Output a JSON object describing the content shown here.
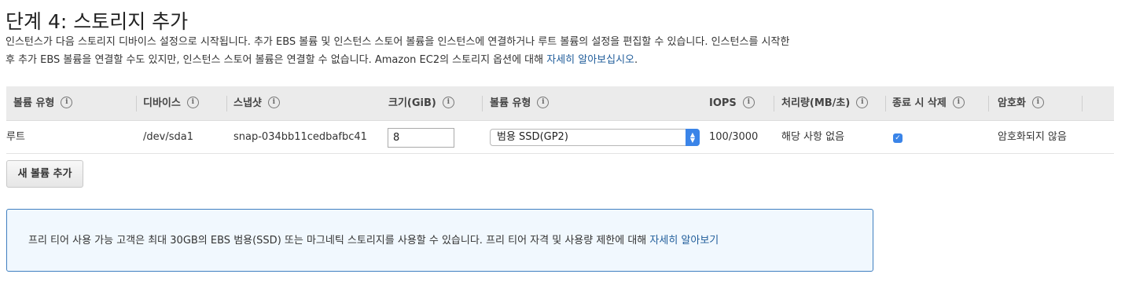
{
  "page": {
    "title": "단계 4: 스토리지 추가",
    "description_line1": "인스턴스가 다음 스토리지 디바이스 설정으로 시작됩니다. 추가 EBS 볼륨 및 인스턴스 스토어 볼륨을 인스턴스에 연결하거나 루트 볼륨의 설정을 편집할 수 있습니다. 인스턴스를 시작한",
    "description_line2": "후 추가 EBS 볼륨을 연결할 수도 있지만, 인스턴스 스토어 볼륨은 연결할 수 없습니다. Amazon EC2의 스토리지 옵션에 대해 ",
    "description_link": "자세히 알아보십시오",
    "description_end": "."
  },
  "table": {
    "info_glyph": "i",
    "headers": {
      "volume_type": "볼륨 유형",
      "device": "디바이스",
      "snapshot": "스냅샷",
      "size": "크기(GiB)",
      "volume_kind": "볼륨 유형",
      "iops": "IOPS",
      "throughput": "처리량(MB/초)",
      "delete_on_termination": "종료 시 삭제",
      "encryption": "암호화"
    },
    "row": {
      "volume_type": "루트",
      "device": "/dev/sda1",
      "snapshot": "snap-034bb11cedbafbc41",
      "size": "8",
      "volume_kind": "범용 SSD(GP2)",
      "iops": "100/3000",
      "throughput": "해당 사항 없음",
      "delete_on_termination": true,
      "encryption": "암호화되지 않음"
    }
  },
  "add_volume_button": "새 볼륨 추가",
  "notice": {
    "text": "프리 티어 사용 가능 고객은 최대 30GB의 EBS 범용(SSD) 또는 마그네틱 스토리지를 사용할 수 있습니다. 프리 티어 자격 및 사용량 제한에 대해 ",
    "link": "자세히 알아보기"
  },
  "colors": {
    "link": "#1f5c9a",
    "accent": "#3a84e8",
    "notice_border": "#3f7fc0",
    "notice_bg": "#f1f8fe",
    "header_bg": "#ebebeb"
  },
  "icons": {
    "info": "info-icon",
    "select_arrow": "updown-chevron-icon",
    "checkbox": "checkmark-icon"
  }
}
